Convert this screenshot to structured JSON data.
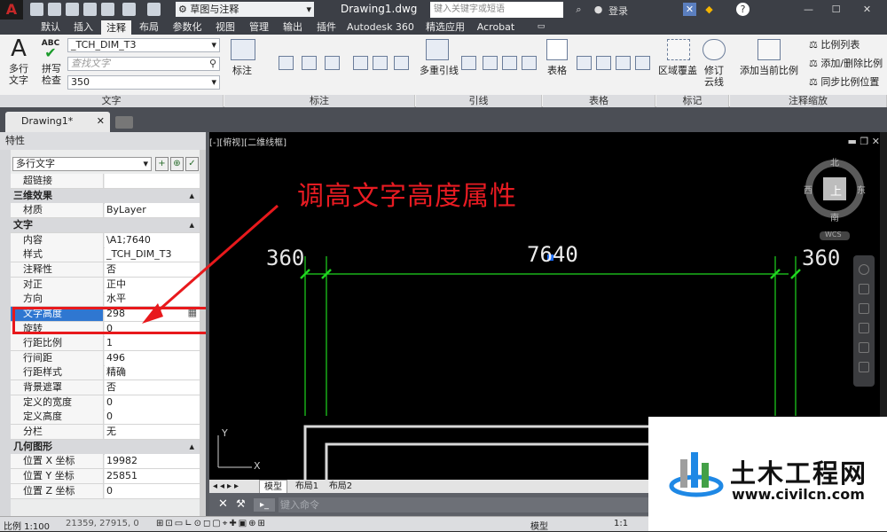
{
  "titlebar": {
    "logo": "A",
    "workspace": "草图与注释",
    "document": "Drawing1.dwg",
    "search_placeholder": "键入关键字或短语",
    "login": "登录",
    "help": "?"
  },
  "menu_tabs": [
    "默认",
    "插入",
    "注释",
    "布局",
    "参数化",
    "视图",
    "管理",
    "输出",
    "插件",
    "Autodesk 360",
    "精选应用",
    "Acrobat"
  ],
  "menu_tabs_active": "注释",
  "ribbon": {
    "text_panel": {
      "title": "文字",
      "multiline_label_1": "多行",
      "multiline_label_2": "文字",
      "spell_label_1": "拼写",
      "spell_label_2": "检查",
      "abc": "ABC",
      "style_value": "_TCH_DIM_T3",
      "find_placeholder": "查找文字",
      "height_value": "350"
    },
    "dim_panel": {
      "title": "标注",
      "dim_label": "标注"
    },
    "leader_panel": {
      "title": "引线",
      "multileader_label": "多重引线"
    },
    "table_panel": {
      "title": "表格",
      "table_label": "表格"
    },
    "markup_panel": {
      "title": "标记",
      "wipeout_label": "区域覆盖",
      "revcloud_label_1": "修订",
      "revcloud_label_2": "云线"
    },
    "scale_panel": {
      "title": "注释缩放",
      "add_current_scale": "添加当前比例",
      "scale_list": "比例列表",
      "add_delete_scale": "添加/删除比例",
      "sync_scale": "同步比例位置"
    }
  },
  "doc_tab": "Drawing1*",
  "properties": {
    "header": "特性",
    "object_type": "多行文字",
    "rows": [
      {
        "k": "超链接",
        "v": ""
      },
      {
        "k": "三维效果",
        "v": "",
        "section": true
      },
      {
        "k": "材质",
        "v": "ByLayer"
      },
      {
        "k": "文字",
        "v": "",
        "section": true
      },
      {
        "k": "内容",
        "v": "\\A1;7640"
      },
      {
        "k": "样式",
        "v": "_TCH_DIM_T3"
      },
      {
        "k": "注释性",
        "v": "否"
      },
      {
        "k": "对正",
        "v": "正中"
      },
      {
        "k": "方向",
        "v": "水平"
      },
      {
        "k": "文字高度",
        "v": "298",
        "highlight": true
      },
      {
        "k": "旋转",
        "v": "0"
      },
      {
        "k": "行距比例",
        "v": "1"
      },
      {
        "k": "行间距",
        "v": "496"
      },
      {
        "k": "行距样式",
        "v": "精确"
      },
      {
        "k": "背景遮罩",
        "v": "否"
      },
      {
        "k": "定义的宽度",
        "v": "0"
      },
      {
        "k": "定义高度",
        "v": "0"
      },
      {
        "k": "分栏",
        "v": "无"
      },
      {
        "k": "几何图形",
        "v": "",
        "section": true
      },
      {
        "k": "位置 X 坐标",
        "v": "19982"
      },
      {
        "k": "位置 Y 坐标",
        "v": "25851"
      },
      {
        "k": "位置 Z 坐标",
        "v": "0"
      }
    ]
  },
  "viewport": {
    "title": "[-][俯视][二维线框]",
    "annotation": "调高文字高度属性",
    "dims": {
      "left": "360",
      "center": "7640",
      "right": "360"
    },
    "viewcube": {
      "n": "北",
      "s": "南",
      "e": "东",
      "w": "西",
      "top": "上",
      "wcs": "WCS"
    },
    "ucs_y": "Y",
    "ucs_x": "X"
  },
  "layout_tabs": [
    "模型",
    "布局1",
    "布局2"
  ],
  "command_placeholder": "键入命令",
  "status": {
    "scale": "比例 1:100",
    "coords": "21359, 27915, 0",
    "anno": "模型",
    "zoom": "1:1"
  },
  "watermark": {
    "brand": "土木工程网",
    "url": "www.civilcn.com"
  },
  "colors": {
    "accent": "#2f77d1",
    "annotation_red": "#e8191c",
    "dim_green": "#1fd51f",
    "cad_bg": "#000000"
  }
}
